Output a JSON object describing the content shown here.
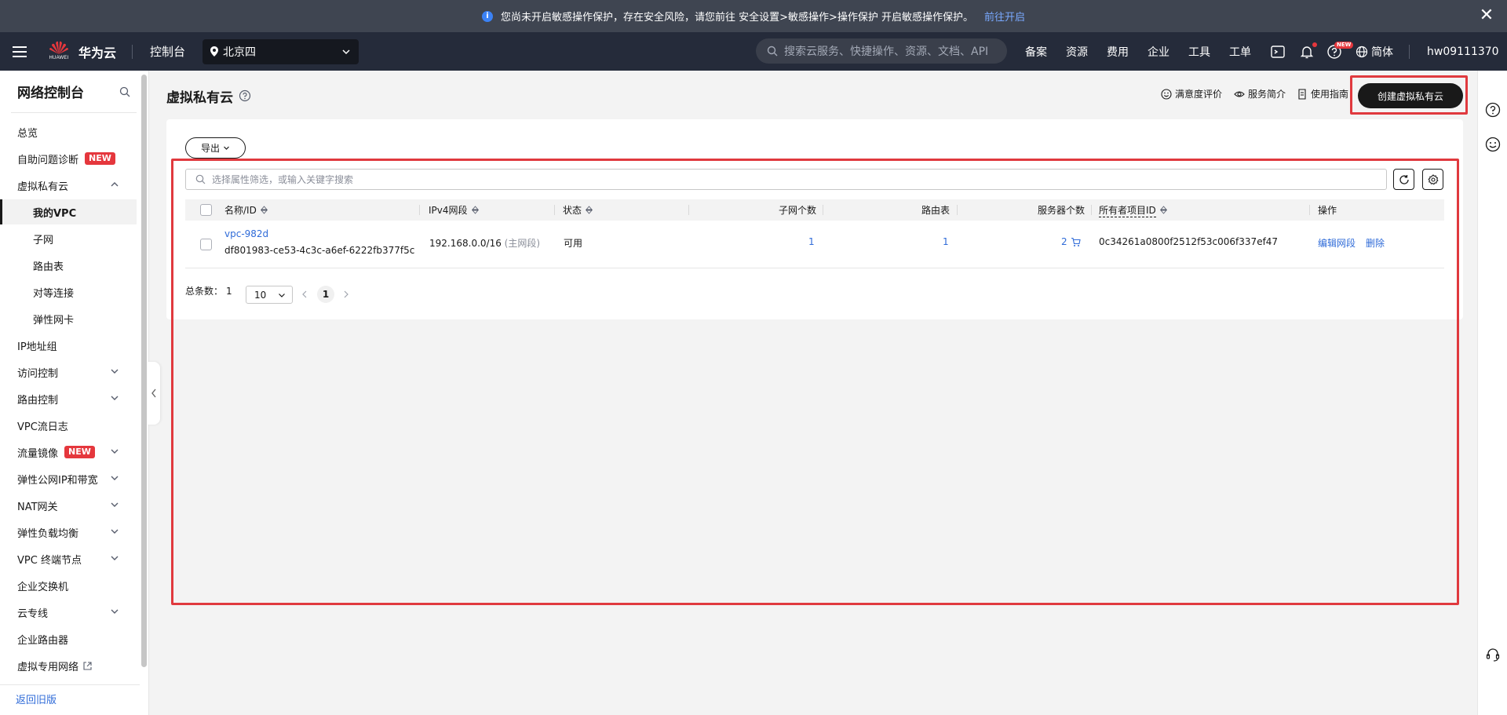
{
  "notice": {
    "message": "您尚未开启敏感操作保护，存在安全风险，请您前往 安全设置>敏感操作>操作保护 开启敏感操作保护。",
    "link": "前往开启",
    "info_glyph": "i",
    "close_glyph": "✕"
  },
  "topnav": {
    "logo_caption": "HUAWEI",
    "logo_text": "华为云",
    "console": "控制台",
    "region": "北京四",
    "search_placeholder": "搜索云服务、快捷操作、资源、文档、API",
    "menu": [
      "备案",
      "资源",
      "费用",
      "企业",
      "工具",
      "工单"
    ],
    "new_badge": "NEW",
    "language": "简体",
    "user": "hw09111370"
  },
  "sidebar": {
    "title": "网络控制台",
    "items": [
      {
        "label": "总览"
      },
      {
        "label": "自助问题诊断",
        "badge": "NEW"
      },
      {
        "label": "虚拟私有云",
        "expanded": true
      },
      {
        "label": "我的VPC",
        "sub": true,
        "active": true
      },
      {
        "label": "子网",
        "sub": true
      },
      {
        "label": "路由表",
        "sub": true
      },
      {
        "label": "对等连接",
        "sub": true
      },
      {
        "label": "弹性网卡",
        "sub": true
      },
      {
        "label": "IP地址组"
      },
      {
        "label": "访问控制"
      },
      {
        "label": "路由控制"
      },
      {
        "label": "VPC流日志"
      },
      {
        "label": "流量镜像",
        "badge": "NEW"
      },
      {
        "label": "弹性公网IP和带宽"
      },
      {
        "label": "NAT网关"
      },
      {
        "label": "弹性负载均衡"
      },
      {
        "label": "VPC 终端节点"
      },
      {
        "label": "企业交换机"
      },
      {
        "label": "云专线"
      },
      {
        "label": "企业路由器"
      },
      {
        "label": "虚拟专用网络"
      }
    ],
    "back_link": "返回旧版"
  },
  "header": {
    "title": "虚拟私有云",
    "links": [
      "满意度评价",
      "服务简介",
      "使用指南"
    ],
    "create_button": "创建虚拟私有云"
  },
  "toolbar": {
    "export": "导出",
    "filter_placeholder": "选择属性筛选，或输入关键字搜索"
  },
  "table": {
    "columns": [
      "名称/ID",
      "IPv4网段",
      "状态",
      "子网个数",
      "路由表",
      "服务器个数",
      "所有者项目ID",
      "操作"
    ],
    "rows": [
      {
        "name": "vpc-982d",
        "id": "df801983-ce53-4c3c-a6ef-6222fb377f5c",
        "ipv4": "192.168.0.0/16",
        "ipv4_note": "(主网段)",
        "status": "可用",
        "subnets": "1",
        "route_tables": "1",
        "servers": "2",
        "owner_project_id": "0c34261a0800f2512f53c006f337ef47",
        "actions": [
          "编辑网段",
          "删除"
        ]
      }
    ]
  },
  "pagination": {
    "total_label": "总条数：",
    "total": "1",
    "page_size": "10",
    "current_page": "1"
  },
  "colors": {
    "accent_link": "#2f6bd8",
    "badge_red": "#e5373d",
    "highlight_box": "#e0393e",
    "nav_dark": "#252b3a"
  }
}
